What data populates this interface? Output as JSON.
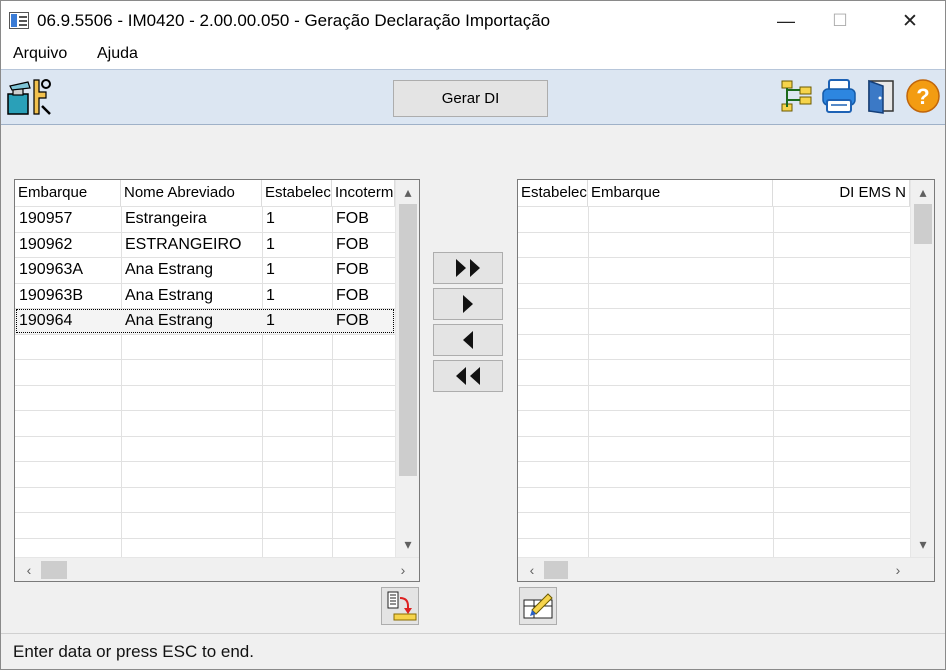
{
  "window": {
    "title": "06.9.5506 - IM0420 - 2.00.00.050 - Geração Declaração Importação",
    "minimize": "—",
    "maximize": "☐",
    "close": "✕"
  },
  "menu": {
    "items": [
      "Arquivo",
      "Ajuda"
    ]
  },
  "toolbar": {
    "gerar_label": "Gerar DI",
    "icons": [
      "tools-icon",
      "tree-structure-icon",
      "print-icon",
      "exit-door-icon",
      "help-icon"
    ]
  },
  "left_grid": {
    "columns": [
      "Embarque",
      "Nome Abreviado",
      "Estabelec",
      "Incoterm"
    ],
    "rows": [
      [
        "190957",
        "Estrangeira",
        "1",
        "FOB"
      ],
      [
        "190962",
        "ESTRANGEIRO",
        "1",
        "FOB"
      ],
      [
        "190963A",
        "Ana Estrang",
        "1",
        "FOB"
      ],
      [
        "190963B",
        "Ana Estrang",
        "1",
        "FOB"
      ],
      [
        "190964",
        "Ana Estrang",
        "1",
        "FOB"
      ]
    ],
    "selected_index": 4
  },
  "right_grid": {
    "columns": [
      "Estabelec",
      "Embarque",
      "DI EMS N"
    ],
    "rows": []
  },
  "move_buttons": [
    "move-all-right",
    "move-right",
    "move-left",
    "move-all-left"
  ],
  "status": {
    "text": "Enter data or press ESC to end."
  }
}
